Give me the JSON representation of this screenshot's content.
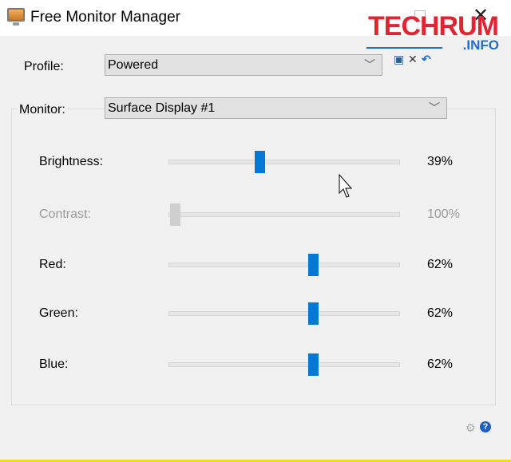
{
  "window": {
    "title": "Free Monitor Manager",
    "icon": "monitor-icon"
  },
  "watermark": {
    "main": "TECHRUM",
    "suffix": ".INFO"
  },
  "profile": {
    "label": "Profile:",
    "value": "Powered",
    "tools": [
      "save-icon",
      "delete-icon",
      "undo-icon"
    ]
  },
  "monitor": {
    "label": "Monitor:",
    "value": "Surface Display #1"
  },
  "sliders": [
    {
      "label": "Brightness:",
      "value_text": "39%",
      "position": 39,
      "enabled": true
    },
    {
      "label": "Contrast:",
      "value_text": "100%",
      "position": 0,
      "enabled": false
    },
    {
      "label": "Red:",
      "value_text": "62%",
      "position": 62,
      "enabled": true
    },
    {
      "label": "Green:",
      "value_text": "62%",
      "position": 62,
      "enabled": true
    },
    {
      "label": "Blue:",
      "value_text": "62%",
      "position": 62,
      "enabled": true
    }
  ],
  "colors": {
    "accent": "#0078d7",
    "disabled": "#cfcfcf"
  },
  "footer": {
    "icons": [
      "settings-icon",
      "help-icon"
    ]
  }
}
